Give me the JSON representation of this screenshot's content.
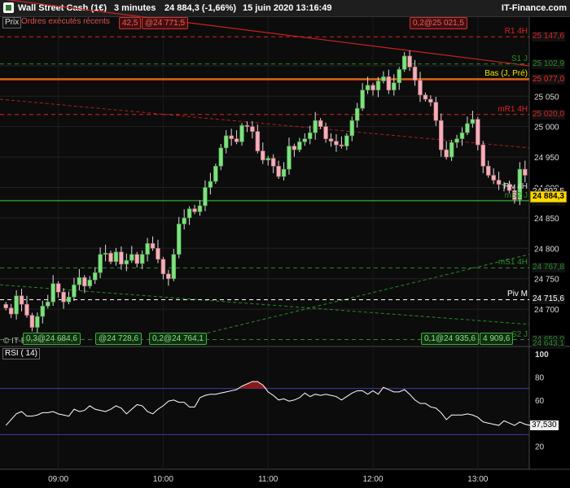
{
  "header": {
    "instrument": "Wall Street Cash (1€)",
    "timeframe": "3 minutes",
    "last": "24 884,3 (-1,66%)",
    "datetime": "15 juin 2020 13:16:49",
    "brand": "IT-Finance.com"
  },
  "panel": {
    "prix_label": "Prix",
    "orders_label": "Ordres exécutés récents",
    "copyright": "© IT-Finance.com",
    "rsi_label": "RSI ( 14)",
    "rsi_value": "37,530"
  },
  "orders": [
    {
      "text": "0,3@24 684,6",
      "color": "#44aa44"
    },
    {
      "text": "@24 728,6",
      "color": "#44aa44"
    },
    {
      "text": "0,2@24 764,1",
      "color": "#44aa44"
    },
    {
      "text": "0,1@24 935,6",
      "color": "#44aa44"
    },
    {
      "text": "4 909,6",
      "color": "#44aa44"
    },
    {
      "text": "42,5",
      "color": "#cc3333"
    },
    {
      "text": "@24 771,5",
      "color": "#cc3333"
    },
    {
      "text": "0,2@25 021,5",
      "color": "#cc3333"
    }
  ],
  "levels": [
    {
      "name": "R1 4H",
      "value": 25147.6,
      "label": "25 147,6",
      "color": "#dd2222",
      "style": "dash"
    },
    {
      "name": "S1 J",
      "value": 25102.9,
      "label": "25 102,9",
      "color": "#2a8a2a",
      "style": "dash"
    },
    {
      "name": "Bas (J, Pré)",
      "value": 25078.0,
      "label": "25 078,0",
      "color": "#e8e800",
      "style": "solid"
    },
    {
      "name": "",
      "value": 25077.0,
      "label": "25 077,0",
      "color": "#ff2222",
      "style": "solid"
    },
    {
      "name": "mR1 4H",
      "value": 25020.0,
      "label": "25 020,0",
      "color": "#dd2222",
      "style": "dash"
    },
    {
      "name": "Piv 4H",
      "value": 24892.5,
      "label": "24 892,5",
      "color": "#dddddd",
      "style": "none"
    },
    {
      "name": "mS2 J",
      "value": 24878.4,
      "label": "24 878,4",
      "color": "#2a8a2a",
      "style": "solid"
    },
    {
      "name": "mS1 4H",
      "value": 24767.8,
      "label": "24 767,8",
      "color": "#2a8a2a",
      "style": "dash"
    },
    {
      "name": "Piv M",
      "value": 24715.6,
      "label": "24 715,6",
      "color": "#ffffff",
      "style": "dash"
    },
    {
      "name": "S2 J",
      "value": 24650.0,
      "label": "24 650,0",
      "color": "#2a8a2a",
      "style": "dash"
    },
    {
      "name": "",
      "value": 24643.1,
      "label": "24 643,1",
      "color": "#2a8a2a",
      "style": "none"
    }
  ],
  "price_tag": {
    "label": "24 884,3",
    "value": 24884.3
  },
  "chart_data": [
    {
      "type": "candlestick",
      "title": "Wall Street Cash (1€) 3 minutes",
      "ylim": [
        24640,
        25180
      ],
      "y_ticks": [
        {
          "v": 25100,
          "t": "25 100"
        },
        {
          "v": 25050,
          "t": "25 050"
        },
        {
          "v": 25000,
          "t": "25 000"
        },
        {
          "v": 24950,
          "t": "24 950"
        },
        {
          "v": 24900,
          "t": "24 900"
        },
        {
          "v": 24850,
          "t": "24 850"
        },
        {
          "v": 24800,
          "t": "24 800"
        },
        {
          "v": 24750,
          "t": "24 750"
        },
        {
          "v": 24700,
          "t": "24 700"
        }
      ],
      "x_ticks": [
        {
          "t": "09:00",
          "bar": 10
        },
        {
          "t": "10:00",
          "bar": 30
        },
        {
          "t": "11:00",
          "bar": 50
        },
        {
          "t": "12:00",
          "bar": 70
        },
        {
          "t": "13:00",
          "bar": 90
        }
      ],
      "close": [
        24702,
        24692,
        24722,
        24708,
        24690,
        24670,
        24688,
        24705,
        24712,
        24742,
        24728,
        24712,
        24720,
        24740,
        24752,
        24738,
        24748,
        24760,
        24790,
        24792,
        24778,
        24794,
        24774,
        24780,
        24790,
        24775,
        24790,
        24808,
        24800,
        24782,
        24758,
        24750,
        24790,
        24840,
        24850,
        24865,
        24860,
        24870,
        24900,
        24910,
        24935,
        24965,
        24985,
        24980,
        24975,
        25002,
        25000,
        24992,
        24960,
        24945,
        24948,
        24935,
        24918,
        24930,
        24968,
        24962,
        24975,
        24980,
        24990,
        25010,
        25000,
        24980,
        24976,
        24970,
        24968,
        24985,
        25010,
        25030,
        25060,
        25068,
        25060,
        25075,
        25082,
        25060,
        25072,
        25094,
        25116,
        25098,
        25076,
        25052,
        25045,
        25040,
        25010,
        24962,
        24950,
        24974,
        24980,
        24990,
        25005,
        25012,
        24970,
        24935,
        24920,
        24912,
        24905,
        24905,
        24895,
        24880,
        24930,
        24920
      ]
    },
    {
      "type": "line",
      "title": "RSI ( 14)",
      "ylim": [
        0,
        100
      ],
      "y_ticks": [
        100,
        80,
        60,
        40,
        20
      ],
      "bands": [
        70,
        30
      ],
      "values": [
        38,
        43,
        48,
        50,
        46,
        46,
        47,
        49,
        49,
        50,
        48,
        47,
        46,
        52,
        50,
        51,
        55,
        52,
        51,
        50,
        52,
        55,
        53,
        48,
        52,
        56,
        55,
        50,
        48,
        52,
        55,
        59,
        60,
        58,
        58,
        54,
        54,
        62,
        64,
        65,
        65,
        66,
        67,
        68,
        69,
        72,
        74,
        76,
        76,
        73,
        67,
        64,
        60,
        61,
        59,
        60,
        62,
        66,
        63,
        65,
        64,
        65,
        64,
        63,
        60,
        63,
        66,
        68,
        68,
        65,
        68,
        65,
        71,
        69,
        67,
        67,
        69,
        65,
        60,
        57,
        57,
        54,
        53,
        49,
        43,
        47,
        47,
        47,
        48,
        47,
        45,
        41,
        40,
        39,
        38,
        42,
        40,
        38,
        41,
        39,
        38
      ]
    }
  ]
}
